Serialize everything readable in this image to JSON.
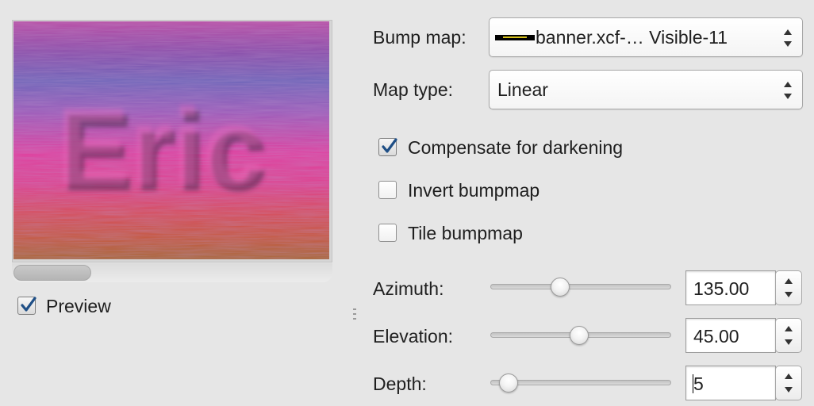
{
  "preview": {
    "image_text": "Eric",
    "label": "Preview",
    "checked": true
  },
  "bump_map": {
    "label": "Bump map:",
    "value": "banner.xcf-… Visible-11"
  },
  "map_type": {
    "label": "Map type:",
    "value": "Linear"
  },
  "options": {
    "compensate": {
      "label": "Compensate for darkening",
      "checked": true
    },
    "invert": {
      "label": "Invert bumpmap",
      "checked": false
    },
    "tile": {
      "label": "Tile bumpmap",
      "checked": false
    }
  },
  "azimuth": {
    "label": "Azimuth:",
    "value": "135.00",
    "min": 0,
    "max": 360,
    "current": 135
  },
  "elevation": {
    "label": "Elevation:",
    "value": "45.00",
    "min": 0.5,
    "max": 90,
    "current": 45
  },
  "depth": {
    "label": "Depth:",
    "value": "5",
    "min": 1,
    "max": 65,
    "current": 5
  },
  "colors": {
    "checkbox_check": "#1f4f86",
    "window_bg": "#e6e6e6"
  }
}
